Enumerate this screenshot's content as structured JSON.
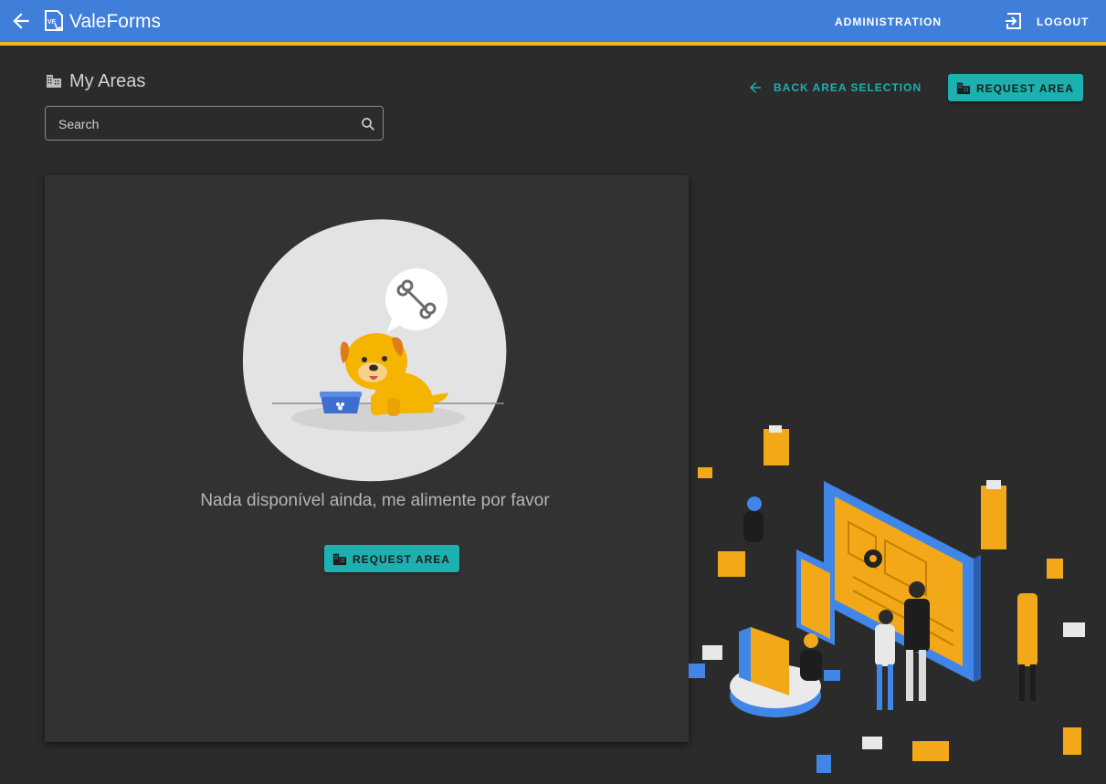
{
  "header": {
    "app_title": "ValeForms",
    "admin_label": "ADMINISTRATION",
    "logout_label": "LOGOUT",
    "colors": {
      "bar": "#3f7fd9",
      "underline": "#f2b51c"
    },
    "icons": [
      "arrow-back-icon",
      "valeforms-logo-icon",
      "logout-icon"
    ]
  },
  "page": {
    "title": "My Areas",
    "title_icon": "buildings-icon",
    "back_area_label": "BACK AREA SELECTION",
    "request_area_label": "REQUEST AREA"
  },
  "search": {
    "placeholder": "Search",
    "value": ""
  },
  "empty_state": {
    "message": "Nada disponível ainda, me alimente por favor",
    "button_label": "REQUEST AREA",
    "illustration": "hungry-dog-with-bowl"
  },
  "accent_color": "#1cb0b0"
}
